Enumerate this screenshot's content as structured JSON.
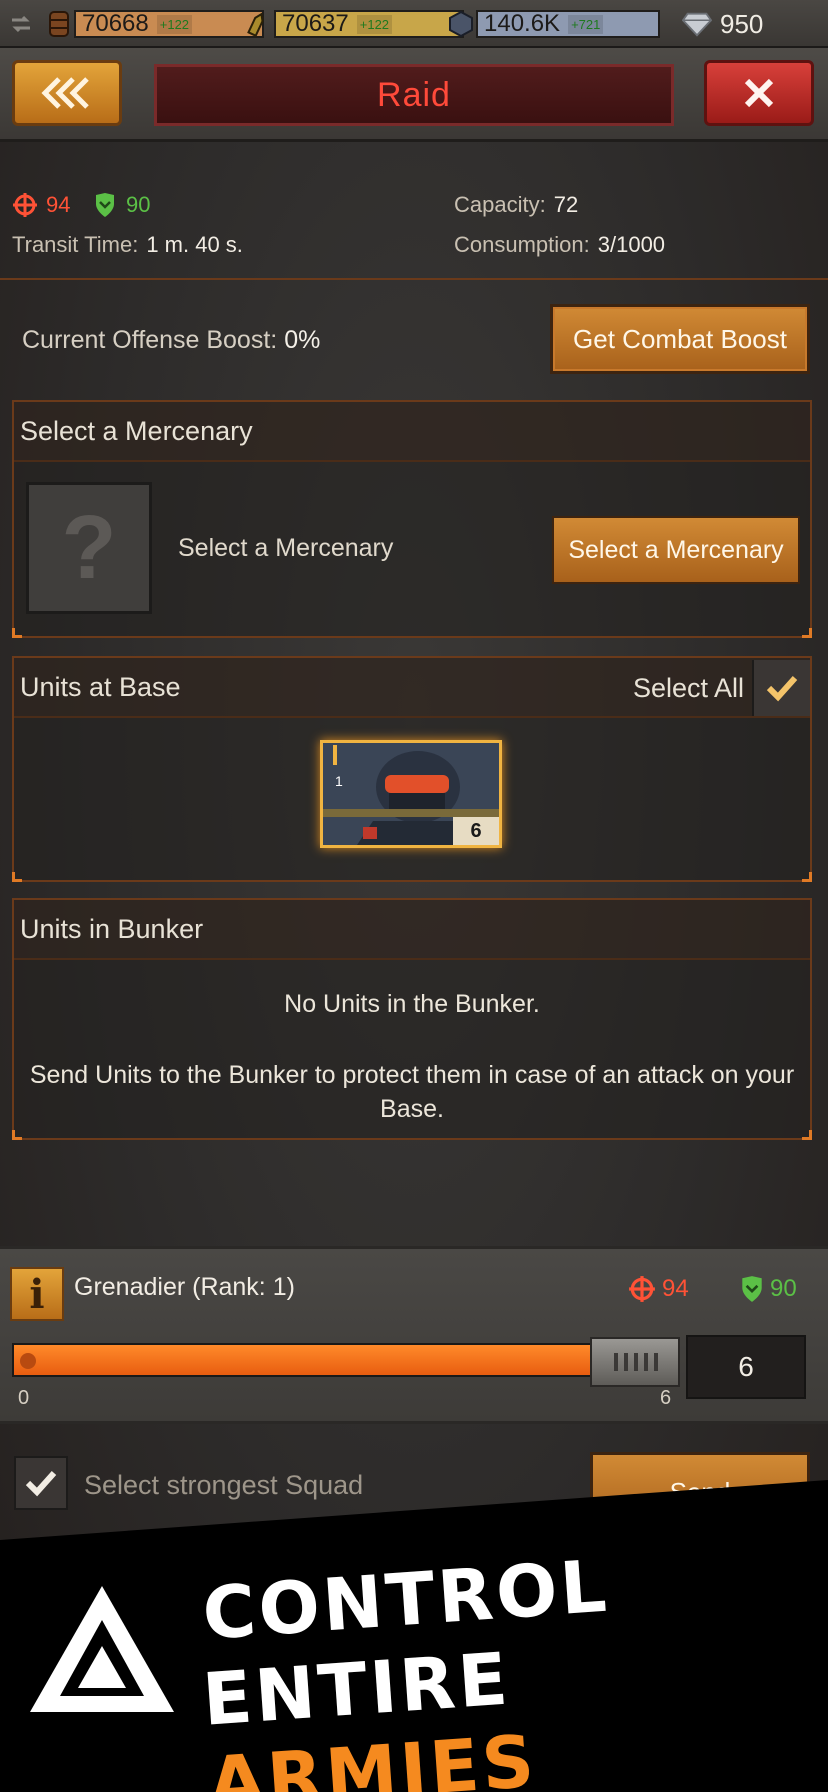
{
  "resources": {
    "barrel": {
      "value": "70668",
      "gain": "+122"
    },
    "ammo": {
      "value": "70637",
      "gain": "+122"
    },
    "steel": {
      "value": "140.6K",
      "gain": "+721"
    },
    "gems": {
      "value": "950"
    }
  },
  "header": {
    "title": "Raid"
  },
  "stats": {
    "attack": "94",
    "defense": "90",
    "transit_label": "Transit Time:",
    "transit_value": "1 m. 40 s.",
    "capacity_label": "Capacity:",
    "capacity_value": "72",
    "consumption_label": "Consumption:",
    "consumption_value": "3/1000"
  },
  "boost": {
    "label": "Current Offense Boost:",
    "value": "0%",
    "button": "Get Combat Boost"
  },
  "mercenary": {
    "header": "Select a Mercenary",
    "placeholder_glyph": "?",
    "text": "Select a Mercenary",
    "button": "Select a Mercenary"
  },
  "units_at_base": {
    "header": "Units at Base",
    "select_all": "Select All",
    "select_all_checked": true,
    "unit": {
      "rank": "1",
      "count": "6"
    }
  },
  "bunker": {
    "header": "Units in Bunker",
    "empty": "No Units in the Bunker.",
    "hint": "Send Units to the Bunker to protect them in case of an attack on your Base."
  },
  "selected_unit": {
    "info_glyph": "i",
    "name": "Grenadier (Rank: 1)",
    "attack": "94",
    "defense": "90",
    "slider_min": "0",
    "slider_max": "6",
    "slider_value_fraction": 1.0,
    "quantity": "6"
  },
  "squad": {
    "label": "Select strongest Squad",
    "checked": true,
    "send_button": "Send"
  },
  "promo": {
    "line1": "CONTROL",
    "line2_a": "ENTIRE",
    "line2_b": "ARMIES"
  },
  "colors": {
    "accent_orange": "#f58a1f",
    "attack_red": "#ff5236",
    "defense_green": "#5bc046",
    "title_red": "#ff4a3a"
  }
}
